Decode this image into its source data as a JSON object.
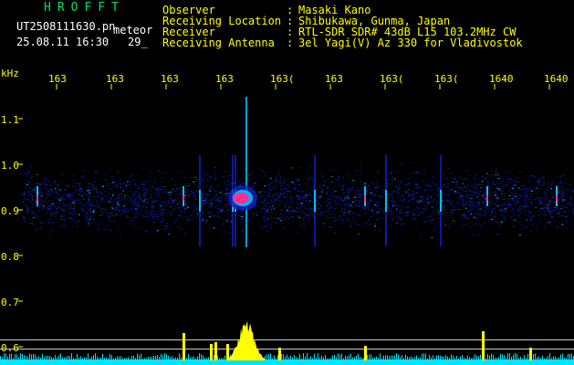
{
  "header": {
    "brand": "HROFFT",
    "filename": "UT2508111630.pn",
    "mode": "meteor",
    "datetime": "25.08.11 16:30",
    "count": "29_",
    "labels": [
      "Observer",
      "Receiving Location",
      "Receiver",
      "Receiving Antenna"
    ],
    "separators": [
      ":",
      ":",
      ":",
      ":"
    ],
    "values": [
      "Masaki Kano",
      "Shibukawa, Gunma, Japan",
      "RTL-SDR SDR# 43dB L15 103.2MHz CW",
      "3el Yagi(V) Az 330 for Vladivostok"
    ]
  },
  "axis": {
    "y_unit": "kHz",
    "y_ticks": [
      "1.1",
      "1.0",
      "0.9",
      "0.8",
      "0.7",
      "0.6"
    ],
    "x_ticks": [
      "163",
      "163",
      "163",
      "163",
      "163(",
      "163",
      "163(",
      "163(",
      "1640"
    ]
  },
  "colors": {
    "background": "#000000",
    "text_primary": "#ffff00",
    "text_brand": "#00e060",
    "text_white": "#ffffff",
    "signal_low": "#1020c0",
    "signal_mid": "#00c0ff",
    "signal_high": "#ff3090",
    "grid_line": "#c8c8c8",
    "baseline": "#00e5ff"
  },
  "chart_data": {
    "type": "heatmap",
    "ylim": [
      0.58,
      1.14
    ],
    "band_center_khz": 0.92,
    "meteor_echo_x_tick_index": 3,
    "vertical_streak_tick_indices": [
      2.6,
      3.2,
      3.25,
      4.7,
      6.0,
      7.0
    ],
    "horizontal_reference_lines_khz": [
      0.615,
      0.595
    ]
  }
}
